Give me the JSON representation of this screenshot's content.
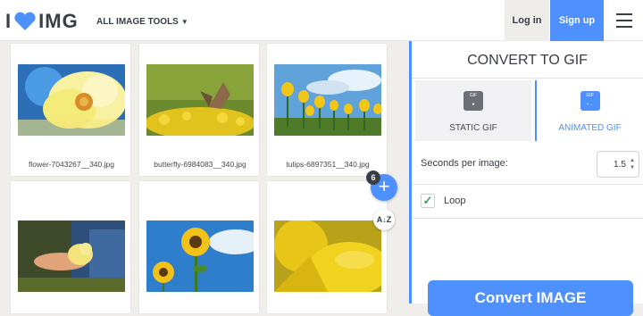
{
  "header": {
    "logo_left": "I",
    "logo_right": "IMG",
    "all_tools": "ALL IMAGE TOOLS",
    "login": "Log in",
    "signup": "Sign up"
  },
  "files": [
    {
      "name": "flower-7043267__340.jpg"
    },
    {
      "name": "butterfly-6984083__340.jpg"
    },
    {
      "name": "tulips-6897351__340.jpg"
    },
    {
      "name": ""
    },
    {
      "name": ""
    },
    {
      "name": ""
    }
  ],
  "fab": {
    "count": "6",
    "add": "+",
    "sort": "A↓Z"
  },
  "sidebar": {
    "title": "CONVERT TO GIF",
    "static_label": "STATIC GIF",
    "animated_label": "ANIMATED GIF",
    "static_icon_text": "GIF",
    "animated_icon_text": "GIF",
    "seconds_label": "Seconds per image:",
    "seconds_value": "1.5",
    "loop_label": "Loop",
    "loop_checked": true,
    "convert_label": "Convert IMAGE"
  },
  "colors": {
    "accent": "#4d90fe",
    "heart": "#4d90fe",
    "dark": "#383e45"
  }
}
